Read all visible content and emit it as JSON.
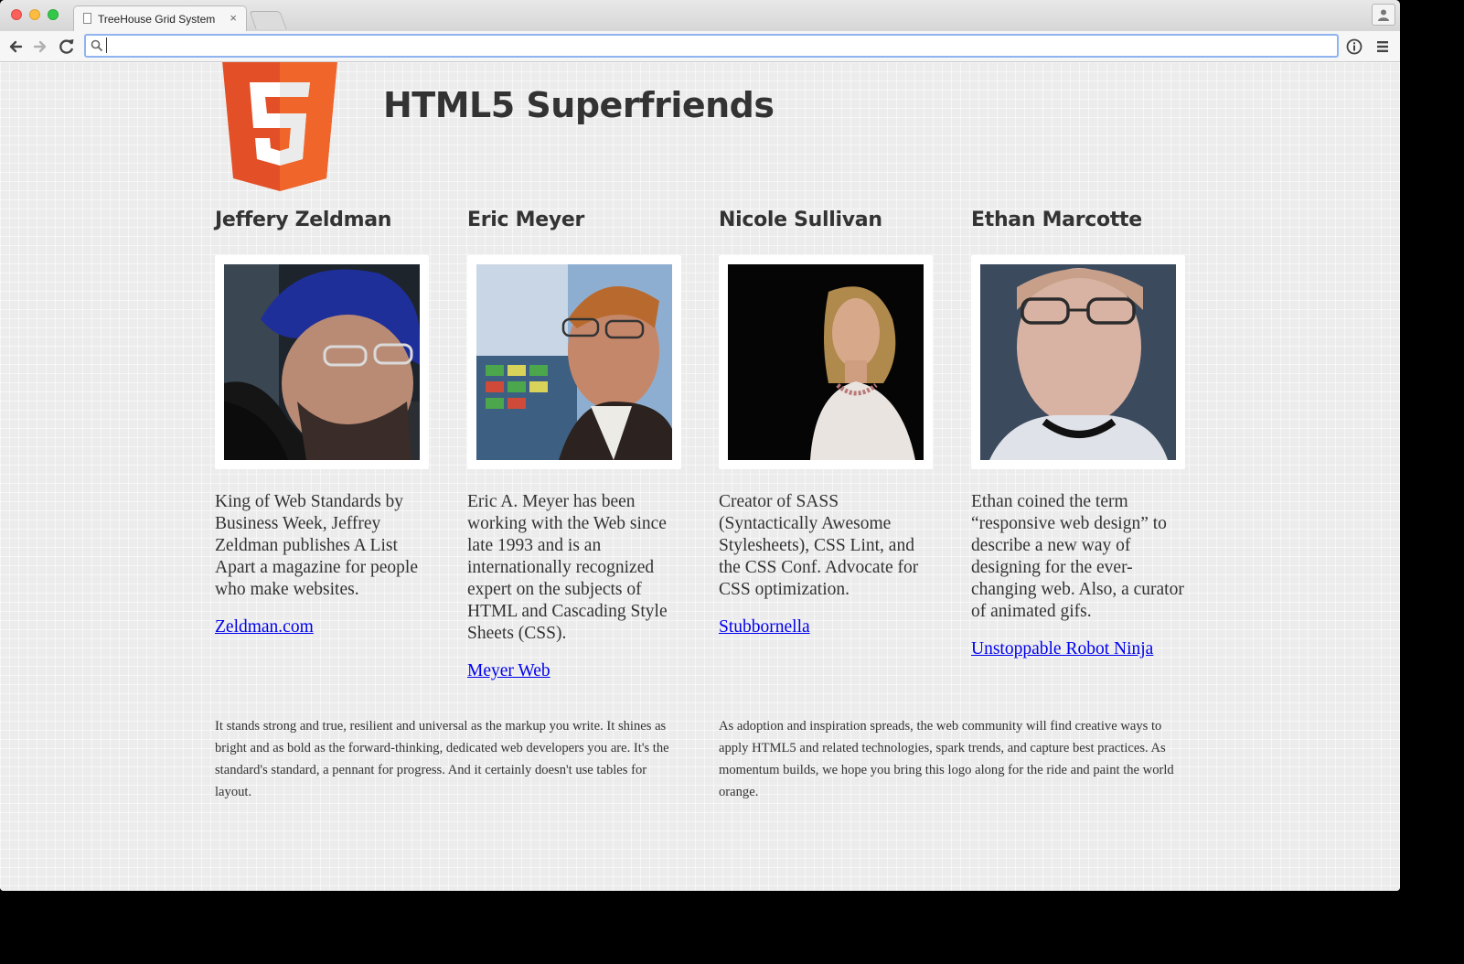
{
  "browser": {
    "tab_title": "TreeHouse Grid System",
    "tab_close": "×",
    "address_value": "",
    "icons": [
      "back-icon",
      "forward-icon",
      "reload-icon",
      "search-icon",
      "info-icon",
      "menu-icon",
      "profile-icon"
    ]
  },
  "page": {
    "title": "HTML5 Superfriends",
    "logo_colors": {
      "dark": "#e34f26",
      "light": "#ef652a"
    },
    "people": [
      {
        "name": "Jeffery Zeldman",
        "bio": "King of Web Standards by Business Week, Jeffrey Zeldman publishes A List Apart a magazine for people who make websites.",
        "link": "Zeldman.com"
      },
      {
        "name": "Eric Meyer",
        "bio": "Eric A. Meyer has been working with the Web since late 1993 and is an internationally recognized expert on the subjects of HTML and Cascading Style Sheets (CSS).",
        "link": "Meyer Web"
      },
      {
        "name": "Nicole Sullivan",
        "bio": "Creator of SASS (Syntactically Awesome Stylesheets), CSS Lint, and the CSS Conf. Advocate for CSS optimization.",
        "link": "Stubbornella"
      },
      {
        "name": "Ethan Marcotte",
        "bio": "Ethan coined the term “responsive web design” to describe a new way of designing for the ever-changing web. Also, a curator of animated gifs.",
        "link": "Unstoppable Robot Ninja"
      }
    ],
    "footer_left": "It stands strong and true, resilient and universal as the markup you write. It shines as bright and as bold as the forward-thinking, dedicated web developers you are. It's the standard's standard, a pennant for progress. And it certainly doesn't use tables for layout.",
    "footer_right": "As adoption and inspiration spreads, the web community will find creative ways to apply HTML5 and related technologies, spark trends, and capture best practices. As momentum builds, we hope you bring this logo along for the ride and paint the world orange."
  }
}
